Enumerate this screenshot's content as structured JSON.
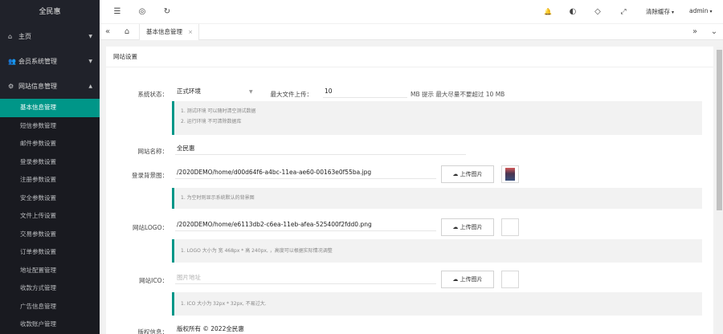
{
  "sidebar": {
    "brand": "全民惠",
    "groups": [
      {
        "label": "主页",
        "icon": "home-icon",
        "glyph": "⌂",
        "arrow": "▼"
      },
      {
        "label": "会员系统管理",
        "icon": "users-icon",
        "glyph": "👥",
        "arrow": "▼"
      },
      {
        "label": "网站信息管理",
        "icon": "gear-icon",
        "glyph": "⚙",
        "arrow": "▲"
      }
    ],
    "sub_items": [
      {
        "label": "基本信息管理"
      },
      {
        "label": "短信参数管理"
      },
      {
        "label": "邮件参数设置"
      },
      {
        "label": "登录参数设置"
      },
      {
        "label": "注册参数设置"
      },
      {
        "label": "安全参数设置"
      },
      {
        "label": "文件上传设置"
      },
      {
        "label": "交易参数设置"
      },
      {
        "label": "订单参数设置"
      },
      {
        "label": "地址配置管理"
      },
      {
        "label": "收款方式管理"
      },
      {
        "label": "广告信息管理"
      },
      {
        "label": "收款账户管理"
      }
    ]
  },
  "header": {
    "menu_glyph": "☰",
    "globe_glyph": "◎",
    "refresh_glyph": "↻",
    "bell_glyph": "🔔",
    "theme_glyph": "◐",
    "tag_glyph": "◇",
    "fullscreen_glyph": "⤢",
    "clear_cache": "清除缓存",
    "user": "admin",
    "caret": "▾"
  },
  "tabs": {
    "left_glyph": "«",
    "home_glyph": "⌂",
    "active_label": "基本信息管理",
    "close_glyph": "×",
    "right_glyph": "»",
    "more_glyph": "⌄"
  },
  "panel": {
    "title": "网站设置",
    "status": {
      "label": "系统状态：",
      "value": "正式环境",
      "caret": "▼"
    },
    "max_upload": {
      "label": "最大文件上传：",
      "value": "10",
      "note": "MB 提示 最大尽量不要超过 10 MB"
    },
    "status_hint": {
      "line1": "1. 测试环境 可以随时清空测试数据",
      "line2": "2. 运行环境 不可清除数据库"
    },
    "site_name": {
      "label": "网站名称：",
      "value": "全民惠"
    },
    "login_bg": {
      "label": "登录背景图：",
      "value": "/2020DEMO/home/d00d64f6-a4bc-11ea-ae60-00163e0f55ba.jpg",
      "hint": "1. 为空时则显示系统默认的背景图"
    },
    "logo": {
      "label": "网站LOGO：",
      "value": "/2020DEMO/home/e6113db2-c6ea-11eb-afea-525400f2fdd0.png",
      "hint": "1. LOGO 大小为 宽 468px * 高 240px, ，高度可以根据实际情况调整"
    },
    "ico": {
      "label": "网站ICO：",
      "placeholder": "图片地址",
      "hint": "1. ICO 大小为 32px * 32px, 不易过大."
    },
    "upload_label": "上传图片",
    "upload_glyph": "☁",
    "copyright": {
      "label": "版权信息：",
      "value": "版权所有 © 2022全民惠"
    }
  },
  "colors": {
    "accent": "#009688",
    "sidebar_bg": "#20222a",
    "submenu_bg": "#191a20"
  }
}
